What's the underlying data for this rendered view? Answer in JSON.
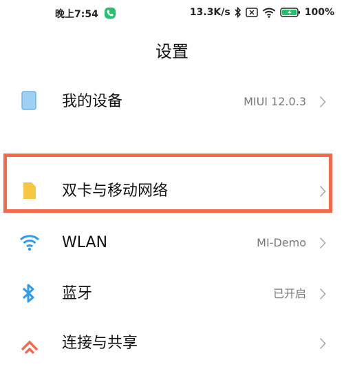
{
  "status_bar": {
    "time": "晚上7:54",
    "net_speed": "13.3K/s",
    "battery": "100%",
    "icons": [
      "call-icon",
      "bluetooth-icon",
      "sim-off-icon",
      "wifi-icon",
      "battery-charging-icon"
    ]
  },
  "header": {
    "title": "设置"
  },
  "settings": {
    "items": [
      {
        "label": "我的设备",
        "value": "MIUI 12.0.3",
        "icon": "device-icon"
      },
      {
        "label": "双卡与移动网络",
        "value": "",
        "icon": "sim-card-icon"
      },
      {
        "label": "WLAN",
        "value": "MI-Demo",
        "icon": "wifi-icon"
      },
      {
        "label": "蓝牙",
        "value": "已开启",
        "icon": "bluetooth-icon"
      },
      {
        "label": "连接与共享",
        "value": "",
        "icon": "connection-share-icon"
      }
    ]
  },
  "colors": {
    "highlight": "#f5694a",
    "device_icon": "#9ed0f3",
    "sim_icon": "#f7c744",
    "wifi_icon": "#2d9cf0",
    "bluetooth_icon": "#2d9cf0",
    "connection_icon": "#f26b4f",
    "call_badge": "#23c16b"
  }
}
